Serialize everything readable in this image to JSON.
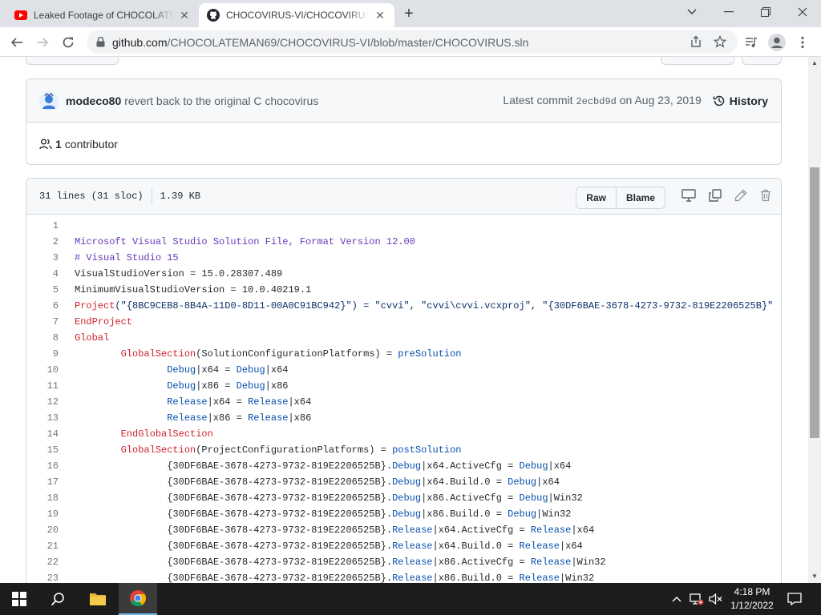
{
  "browser": {
    "tabs": [
      {
        "title": "Leaked Footage of CHOCOLATEMAN",
        "icon": "youtube-icon",
        "active": false
      },
      {
        "title": "CHOCOVIRUS-VI/CHOCOVIRUS.sln",
        "icon": "github-icon",
        "active": true
      }
    ],
    "url_host": "github.com",
    "url_path": "/CHOCOLATEMAN69/CHOCOVIRUS-VI/blob/master/CHOCOVIRUS.sln"
  },
  "commit": {
    "author": "modeco80",
    "message": "revert back to the original C chocovirus",
    "latest_label": "Latest commit",
    "sha": "2ecbd9d",
    "date_text": "on Aug 23, 2019",
    "history_label": "History"
  },
  "contributors": {
    "count": "1",
    "label": "contributor"
  },
  "file": {
    "lines_info": "31 lines (31 sloc)",
    "size": "1.39 KB",
    "raw_label": "Raw",
    "blame_label": "Blame"
  },
  "code_lines": [
    {
      "n": "1",
      "parts": [
        {
          "t": "",
          "c": ""
        }
      ]
    },
    {
      "n": "2",
      "parts": [
        {
          "t": "Microsoft Visual Studio Solution File, Format Version 12.00",
          "c": "t-f"
        }
      ]
    },
    {
      "n": "3",
      "parts": [
        {
          "t": "# Visual Studio 15",
          "c": "t-f"
        }
      ]
    },
    {
      "n": "4",
      "parts": [
        {
          "t": "VisualStudioVersion = 15.0.28307.489",
          "c": ""
        }
      ]
    },
    {
      "n": "5",
      "parts": [
        {
          "t": "MinimumVisualStudioVersion = 10.0.40219.1",
          "c": ""
        }
      ]
    },
    {
      "n": "6",
      "parts": [
        {
          "t": "Project",
          "c": "t-k"
        },
        {
          "t": "(\"{8BC9CEB8-8B4A-11D0-8D11-00A0C91BC942}\") = \"cvvi\", \"cvvi\\cvvi.vcxproj\", \"{30DF6BAE-3678-4273-9732-819E2206525B}\"",
          "c": "t-s"
        }
      ]
    },
    {
      "n": "7",
      "parts": [
        {
          "t": "EndProject",
          "c": "t-k"
        }
      ]
    },
    {
      "n": "8",
      "parts": [
        {
          "t": "Global",
          "c": "t-k"
        }
      ]
    },
    {
      "n": "9",
      "parts": [
        {
          "t": "\t",
          "c": ""
        },
        {
          "t": "GlobalSection",
          "c": "t-k"
        },
        {
          "t": "(SolutionConfigurationPlatforms) = ",
          "c": ""
        },
        {
          "t": "preSolution",
          "c": "t-b"
        }
      ]
    },
    {
      "n": "10",
      "parts": [
        {
          "t": "\t\t",
          "c": ""
        },
        {
          "t": "Debug",
          "c": "t-b"
        },
        {
          "t": "|x64 = ",
          "c": ""
        },
        {
          "t": "Debug",
          "c": "t-b"
        },
        {
          "t": "|x64",
          "c": ""
        }
      ]
    },
    {
      "n": "11",
      "parts": [
        {
          "t": "\t\t",
          "c": ""
        },
        {
          "t": "Debug",
          "c": "t-b"
        },
        {
          "t": "|x86 = ",
          "c": ""
        },
        {
          "t": "Debug",
          "c": "t-b"
        },
        {
          "t": "|x86",
          "c": ""
        }
      ]
    },
    {
      "n": "12",
      "parts": [
        {
          "t": "\t\t",
          "c": ""
        },
        {
          "t": "Release",
          "c": "t-b"
        },
        {
          "t": "|x64 = ",
          "c": ""
        },
        {
          "t": "Release",
          "c": "t-b"
        },
        {
          "t": "|x64",
          "c": ""
        }
      ]
    },
    {
      "n": "13",
      "parts": [
        {
          "t": "\t\t",
          "c": ""
        },
        {
          "t": "Release",
          "c": "t-b"
        },
        {
          "t": "|x86 = ",
          "c": ""
        },
        {
          "t": "Release",
          "c": "t-b"
        },
        {
          "t": "|x86",
          "c": ""
        }
      ]
    },
    {
      "n": "14",
      "parts": [
        {
          "t": "\t",
          "c": ""
        },
        {
          "t": "EndGlobalSection",
          "c": "t-k"
        }
      ]
    },
    {
      "n": "15",
      "parts": [
        {
          "t": "\t",
          "c": ""
        },
        {
          "t": "GlobalSection",
          "c": "t-k"
        },
        {
          "t": "(ProjectConfigurationPlatforms) = ",
          "c": ""
        },
        {
          "t": "postSolution",
          "c": "t-b"
        }
      ]
    },
    {
      "n": "16",
      "parts": [
        {
          "t": "\t\t{30DF6BAE-3678-4273-9732-819E2206525B}.",
          "c": ""
        },
        {
          "t": "Debug",
          "c": "t-b"
        },
        {
          "t": "|x64.ActiveCfg = ",
          "c": ""
        },
        {
          "t": "Debug",
          "c": "t-b"
        },
        {
          "t": "|x64",
          "c": ""
        }
      ]
    },
    {
      "n": "17",
      "parts": [
        {
          "t": "\t\t{30DF6BAE-3678-4273-9732-819E2206525B}.",
          "c": ""
        },
        {
          "t": "Debug",
          "c": "t-b"
        },
        {
          "t": "|x64.Build.0 = ",
          "c": ""
        },
        {
          "t": "Debug",
          "c": "t-b"
        },
        {
          "t": "|x64",
          "c": ""
        }
      ]
    },
    {
      "n": "18",
      "parts": [
        {
          "t": "\t\t{30DF6BAE-3678-4273-9732-819E2206525B}.",
          "c": ""
        },
        {
          "t": "Debug",
          "c": "t-b"
        },
        {
          "t": "|x86.ActiveCfg = ",
          "c": ""
        },
        {
          "t": "Debug",
          "c": "t-b"
        },
        {
          "t": "|Win32",
          "c": ""
        }
      ]
    },
    {
      "n": "19",
      "parts": [
        {
          "t": "\t\t{30DF6BAE-3678-4273-9732-819E2206525B}.",
          "c": ""
        },
        {
          "t": "Debug",
          "c": "t-b"
        },
        {
          "t": "|x86.Build.0 = ",
          "c": ""
        },
        {
          "t": "Debug",
          "c": "t-b"
        },
        {
          "t": "|Win32",
          "c": ""
        }
      ]
    },
    {
      "n": "20",
      "parts": [
        {
          "t": "\t\t{30DF6BAE-3678-4273-9732-819E2206525B}.",
          "c": ""
        },
        {
          "t": "Release",
          "c": "t-b"
        },
        {
          "t": "|x64.ActiveCfg = ",
          "c": ""
        },
        {
          "t": "Release",
          "c": "t-b"
        },
        {
          "t": "|x64",
          "c": ""
        }
      ]
    },
    {
      "n": "21",
      "parts": [
        {
          "t": "\t\t{30DF6BAE-3678-4273-9732-819E2206525B}.",
          "c": ""
        },
        {
          "t": "Release",
          "c": "t-b"
        },
        {
          "t": "|x64.Build.0 = ",
          "c": ""
        },
        {
          "t": "Release",
          "c": "t-b"
        },
        {
          "t": "|x64",
          "c": ""
        }
      ]
    },
    {
      "n": "22",
      "parts": [
        {
          "t": "\t\t{30DF6BAE-3678-4273-9732-819E2206525B}.",
          "c": ""
        },
        {
          "t": "Release",
          "c": "t-b"
        },
        {
          "t": "|x86.ActiveCfg = ",
          "c": ""
        },
        {
          "t": "Release",
          "c": "t-b"
        },
        {
          "t": "|Win32",
          "c": ""
        }
      ]
    },
    {
      "n": "23",
      "parts": [
        {
          "t": "\t\t{30DF6BAE-3678-4273-9732-819E2206525B}.",
          "c": ""
        },
        {
          "t": "Release",
          "c": "t-b"
        },
        {
          "t": "|x86.Build.0 = ",
          "c": ""
        },
        {
          "t": "Release",
          "c": "t-b"
        },
        {
          "t": "|Win32",
          "c": ""
        }
      ]
    }
  ],
  "taskbar": {
    "time": "4:18 PM",
    "date": "1/12/2022"
  },
  "colors": {
    "tabstrip_bg": "#dee1e6",
    "taskbar_bg": "#1c1c1c",
    "link_blue": "#0550ae",
    "keyword_red": "#cf222e"
  }
}
